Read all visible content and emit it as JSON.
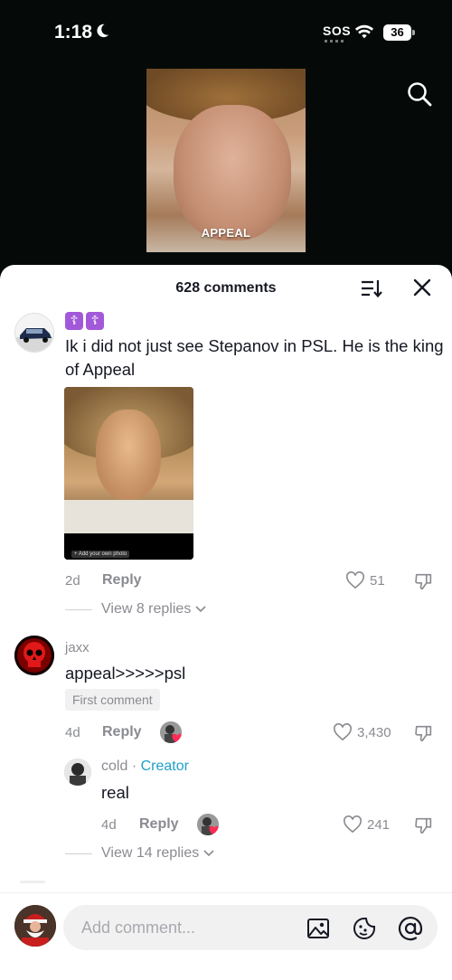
{
  "status_bar": {
    "time": "1:18",
    "sos": "SOS",
    "battery": "36"
  },
  "video": {
    "caption": "APPEAL"
  },
  "comments_sheet": {
    "title": "628 comments",
    "comments": [
      {
        "badges": [
          "☦",
          "☦"
        ],
        "text": "Ik i did not just see Stepanov in PSL. He is the king of Appeal",
        "photo_caption": "+ Add your own photo",
        "time": "2d",
        "reply_label": "Reply",
        "likes": "51",
        "view_replies": "View 8 replies"
      },
      {
        "username": "jaxx",
        "text": "appeal>>>>>psl",
        "badge": "First comment",
        "time": "4d",
        "reply_label": "Reply",
        "likes": "3,430",
        "reply": {
          "username": "cold",
          "separator": "·",
          "creator_label": "Creator",
          "text": "real",
          "time": "4d",
          "reply_label": "Reply",
          "likes": "241"
        },
        "view_replies": "View 14 replies"
      }
    ]
  },
  "composer": {
    "placeholder": "Add comment..."
  },
  "colors": {
    "accent_creator": "#1da1c7",
    "like_heart": "#fe2c55",
    "badge_purple": "#a259d9"
  }
}
